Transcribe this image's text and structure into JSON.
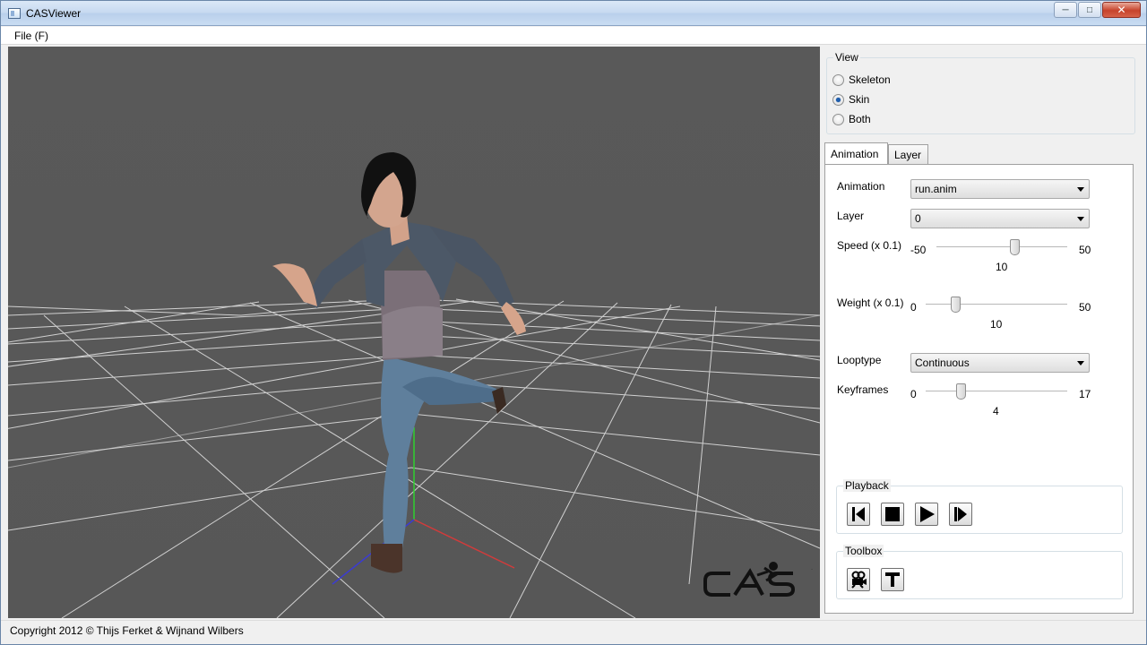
{
  "window": {
    "title": "CASViewer"
  },
  "menu": {
    "file": "File (F)"
  },
  "status": {
    "text": "Copyright 2012 © Thijs Ferket & Wijnand Wilbers"
  },
  "view": {
    "title": "View",
    "options": [
      {
        "label": "Skeleton",
        "checked": false
      },
      {
        "label": "Skin",
        "checked": true
      },
      {
        "label": "Both",
        "checked": false
      }
    ]
  },
  "tabs": {
    "animation": "Animation",
    "layer": "Layer",
    "active": "Animation"
  },
  "animation_tab": {
    "animation_label": "Animation",
    "animation_value": "run.anim",
    "layer_label": "Layer",
    "layer_value": "0",
    "speed": {
      "label": "Speed (x 0.1)",
      "min": "-50",
      "max": "50",
      "value": "10"
    },
    "weight": {
      "label": "Weight (x 0.1)",
      "min": "0",
      "max": "50",
      "value": "10"
    },
    "looptype_label": "Looptype",
    "looptype_value": "Continuous",
    "keyframes": {
      "label": "Keyframes",
      "min": "0",
      "max": "17",
      "value": "4"
    }
  },
  "playback": {
    "title": "Playback",
    "buttons": [
      "step-back-icon",
      "stop-icon",
      "play-icon",
      "step-forward-icon"
    ]
  },
  "toolbox": {
    "title": "Toolbox",
    "buttons": [
      "camera-icon",
      "text-tool-icon"
    ]
  },
  "logo": {
    "text": "CAS"
  },
  "colors": {
    "viewport_bg": "#585858",
    "grid": "#e6e6e6",
    "axis_x": "#d23b3b",
    "axis_y": "#2fd02f",
    "axis_z": "#3b3bd2",
    "accent": "#1e5eae"
  }
}
